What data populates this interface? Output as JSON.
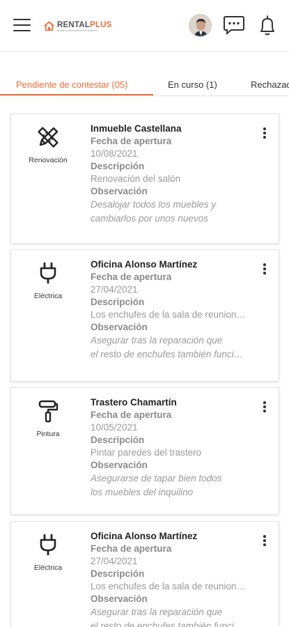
{
  "header": {
    "brand_primary": "RENTAL",
    "brand_accent": "PLUS",
    "brand_tagline": "gestión y administración de alquileres",
    "menu_icon": "hamburger-icon",
    "chat_icon": "chat-bubble-icon",
    "notifications_icon": "bell-icon",
    "accent_color": "#f26a33"
  },
  "tabs": [
    {
      "label": "Pendiente de contestar (05)",
      "active": true
    },
    {
      "label": "En curso (1)",
      "active": false
    },
    {
      "label": "Rechazadas",
      "active": false
    }
  ],
  "fields": {
    "fecha": "Fecha de apertura",
    "descripcion": "Descripción",
    "observacion": "Observación"
  },
  "cards": [
    {
      "category": "Renovación",
      "icon": "pencil-ruler-icon",
      "title": "Inmueble Castellana",
      "fecha": "10/08/2021",
      "descripcion": "Renovación del salón",
      "observacion_1": "Desalojar todos los muebles y",
      "observacion_2": "cambiarlos por unos nuevos"
    },
    {
      "category": "Eléctrica",
      "icon": "plug-icon",
      "title": "Oficina Alonso Martínez",
      "fecha": "27/04/2021",
      "descripcion": "Los enchufes de la sala de reuniones no funcionan",
      "observacion_1": "Asegurar tras la reparación que",
      "observacion_2": " el resto de enchufes también funcionan"
    },
    {
      "category": "Pintura",
      "icon": "paint-roller-icon",
      "title": "Trastero Chamartín",
      "fecha": "10/05/2021",
      "descripcion": "Pintar paredes del trastero",
      "observacion_1": "Asegurarse de tapar bien todos",
      "observacion_2": "los muebles del inquilino"
    },
    {
      "category": "Eléctrica",
      "icon": "plug-icon",
      "title": "Oficina Alonso Martínez",
      "fecha": "27/04/2021",
      "descripcion": "Los enchufes de la sala de reuniones no funcionan",
      "observacion_1": "Asegurar tras la reparación que",
      "observacion_2": " el resto de enchufes también funcionan"
    }
  ]
}
